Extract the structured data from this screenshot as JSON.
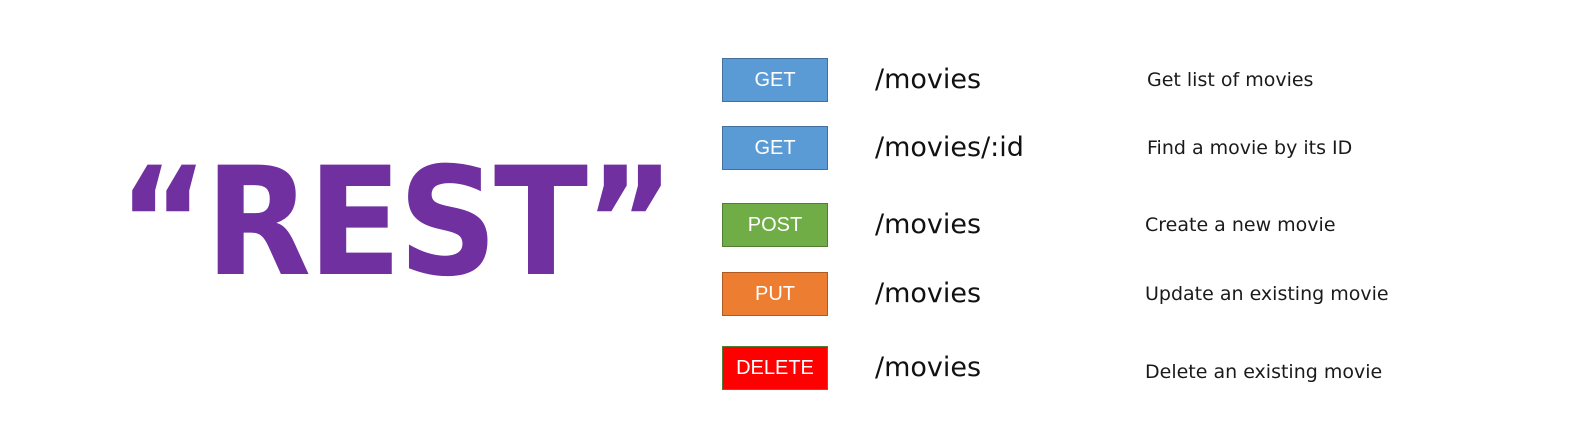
{
  "title": "“REST”",
  "colors": {
    "title": "#7030a0",
    "get": "#5b9bd5",
    "post": "#70ad47",
    "put": "#ed7d31",
    "delete": "#ff0000"
  },
  "routes": [
    {
      "method": "GET",
      "path": "/movies",
      "description": "Get list of movies",
      "color": "#5b9bd5",
      "border": "#41719c"
    },
    {
      "method": "GET",
      "path": "/movies/:id",
      "description": "Find a movie by its ID",
      "color": "#5b9bd5",
      "border": "#41719c"
    },
    {
      "method": "POST",
      "path": "/movies",
      "description": "Create a new movie",
      "color": "#70ad47",
      "border": "#507e32"
    },
    {
      "method": "PUT",
      "path": "/movies",
      "description": "Update an existing movie",
      "color": "#ed7d31",
      "border": "#ae5a21"
    },
    {
      "method": "DELETE",
      "path": "/movies",
      "description": "Delete an existing movie",
      "color": "#ff0000",
      "border": "#507e32"
    }
  ]
}
